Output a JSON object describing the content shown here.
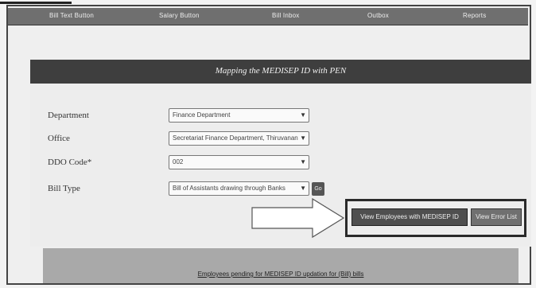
{
  "nav": {
    "items": [
      "Bill Text Button",
      "Salary Button",
      "Bill Inbox",
      "Outbox",
      "Reports"
    ]
  },
  "panel": {
    "title": "Mapping the MEDISEP ID with PEN"
  },
  "form": {
    "fields": [
      {
        "label": "Department",
        "value": "Finance Department"
      },
      {
        "label": "Office",
        "value": "Secretariat Finance Department, Thiruvanant"
      },
      {
        "label": "DDO Code*",
        "value": "002"
      },
      {
        "label": "Bill Type",
        "value": "Bill of Assistants drawing through Banks"
      }
    ],
    "go_label": "Go"
  },
  "actions": {
    "primary_label": "View Employees with MEDISEP ID",
    "secondary_label": "View Error List"
  },
  "footer": {
    "link_text": "Employees pending for MEDISEP ID updation for (Bill) bills"
  },
  "colors": {
    "navbar": "#6f6f6f",
    "panel_header": "#3e3e3e",
    "footer_bar": "#a9a9a9"
  }
}
